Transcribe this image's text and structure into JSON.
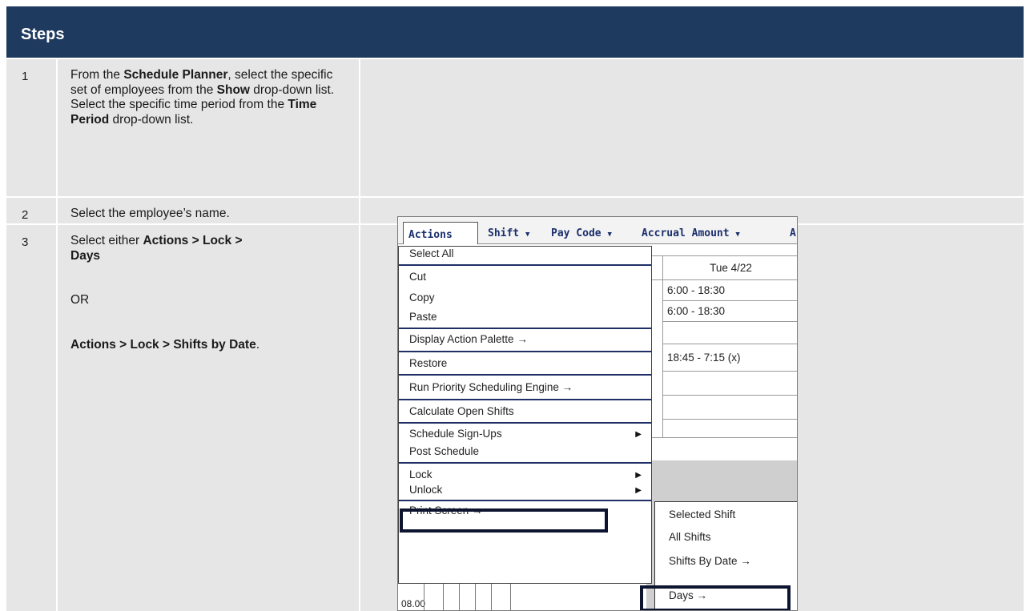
{
  "steps": {
    "header": "Steps",
    "rows": [
      {
        "num": "1",
        "parts": [
          "From the ",
          "Schedule Planner",
          ", select the specific set of employees from the ",
          "Show",
          " drop-down list. Select the specific time period from the ",
          "Time Period",
          " drop-down list."
        ]
      },
      {
        "num": "2",
        "text": "Select the employee’s name."
      },
      {
        "num": "3",
        "line1": "Select either ",
        "line1_bold": "Actions > Lock > Days",
        "or": "OR",
        "line2_bold": "Actions > Lock > Shifts by Date",
        "line2_end": "."
      }
    ]
  },
  "screenshot": {
    "toolbar": {
      "actions": "Actions",
      "shift": "Shift",
      "pay_code": "Pay Code",
      "accrual_amount": "Accrual Amount",
      "trailing": "A",
      "caret": "▼"
    },
    "grid": {
      "column_header": "Tue 4/22",
      "rows": [
        "6:00 - 18:30",
        "6:00 - 18:30",
        "",
        "18:45 - 7:15 (x)",
        "",
        "",
        ""
      ],
      "bottom_label": "08.00"
    },
    "menu": {
      "items": [
        "Select All",
        "Cut",
        "Copy",
        "Paste",
        "Display Action Palette →",
        "Restore",
        "Run Priority Scheduling Engine →",
        "Calculate Open Shifts",
        "Schedule Sign-Ups",
        "Post Schedule",
        "Lock",
        "Unlock",
        "Print Screen →"
      ],
      "submenu_arrow": "▶"
    },
    "submenu": {
      "items": [
        "Selected Shift",
        "All Shifts",
        "Shifts By Date →",
        "Days →"
      ]
    }
  }
}
